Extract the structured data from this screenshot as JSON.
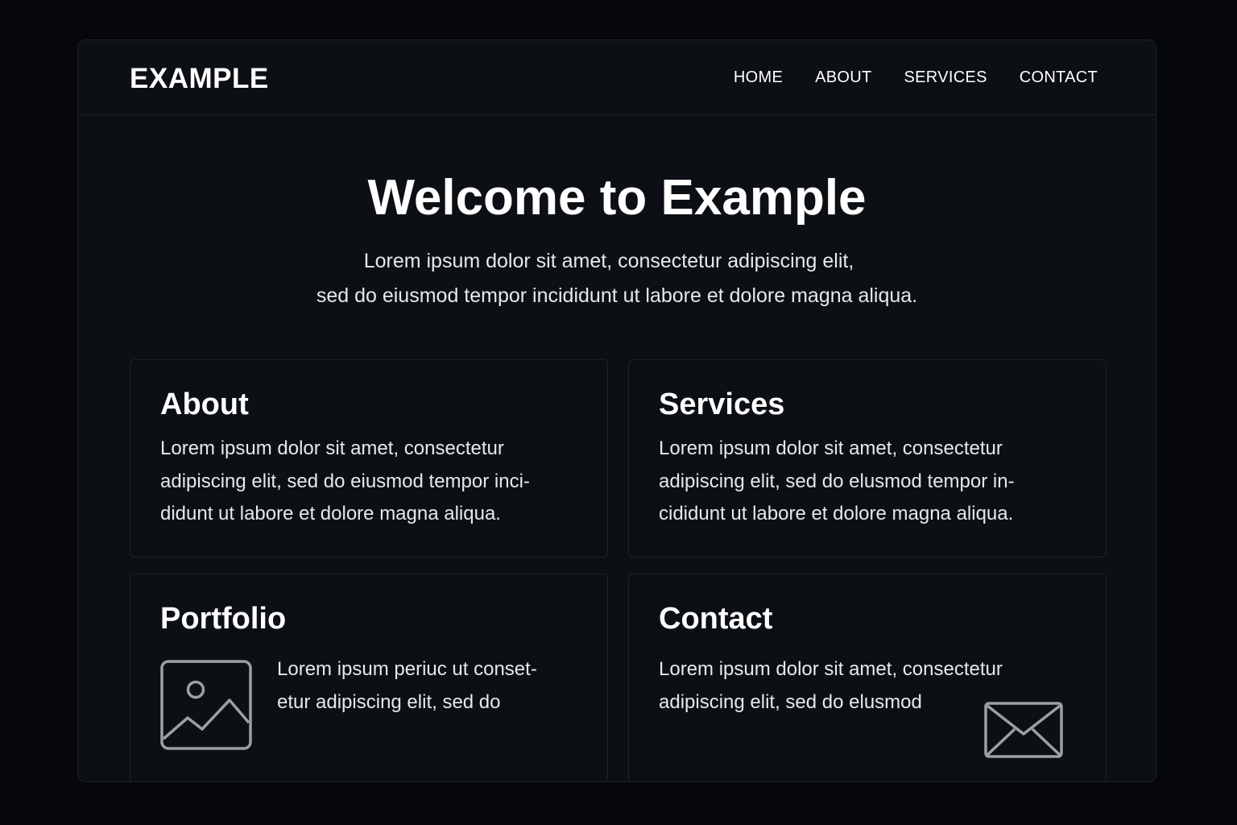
{
  "header": {
    "brand": "EXAMPLE",
    "nav": [
      "HOME",
      "ABOUT",
      "SERVICES",
      "CONTACT"
    ]
  },
  "hero": {
    "title": "Welcome to Example",
    "subtitle_lines": [
      "Lorem ipsum dolor sit amet, consectetur adipiscing elit,",
      "sed do eiusmod tempor incididunt ut labore et dolore magna aliqua."
    ]
  },
  "cards": {
    "about": {
      "title": "About",
      "lines": [
        "Lorem ipsum dolor sit amet, consectetur",
        "adipiscing elit, sed do eiusmod tempor inci-",
        "didunt ut labore et dolore magna aliqua."
      ]
    },
    "services": {
      "title": "Services",
      "lines": [
        "Lorem ipsum dolor sit amet, consectetur",
        "adipiscing elit, sed do elusmod tempor in-",
        "cididunt ut labore et dolore magna aliqua."
      ]
    },
    "portfolio": {
      "title": "Portfolio",
      "icon": "image-icon",
      "lines": [
        "Lorem ipsum periuc ut conset-",
        "etur adipiscing elit, sed do"
      ]
    },
    "contact": {
      "title": "Contact",
      "icon": "mail-icon",
      "lines": [
        "Lorem ipsum dolor sit amet, consectetur",
        "adipiscing elit, sed do elusmod"
      ]
    }
  },
  "colors": {
    "page_background": "#05070a",
    "panel_background": "#0c0f13",
    "border": "#1f242b",
    "text": "#ffffff",
    "icon_stroke": "#9aa0a6"
  }
}
